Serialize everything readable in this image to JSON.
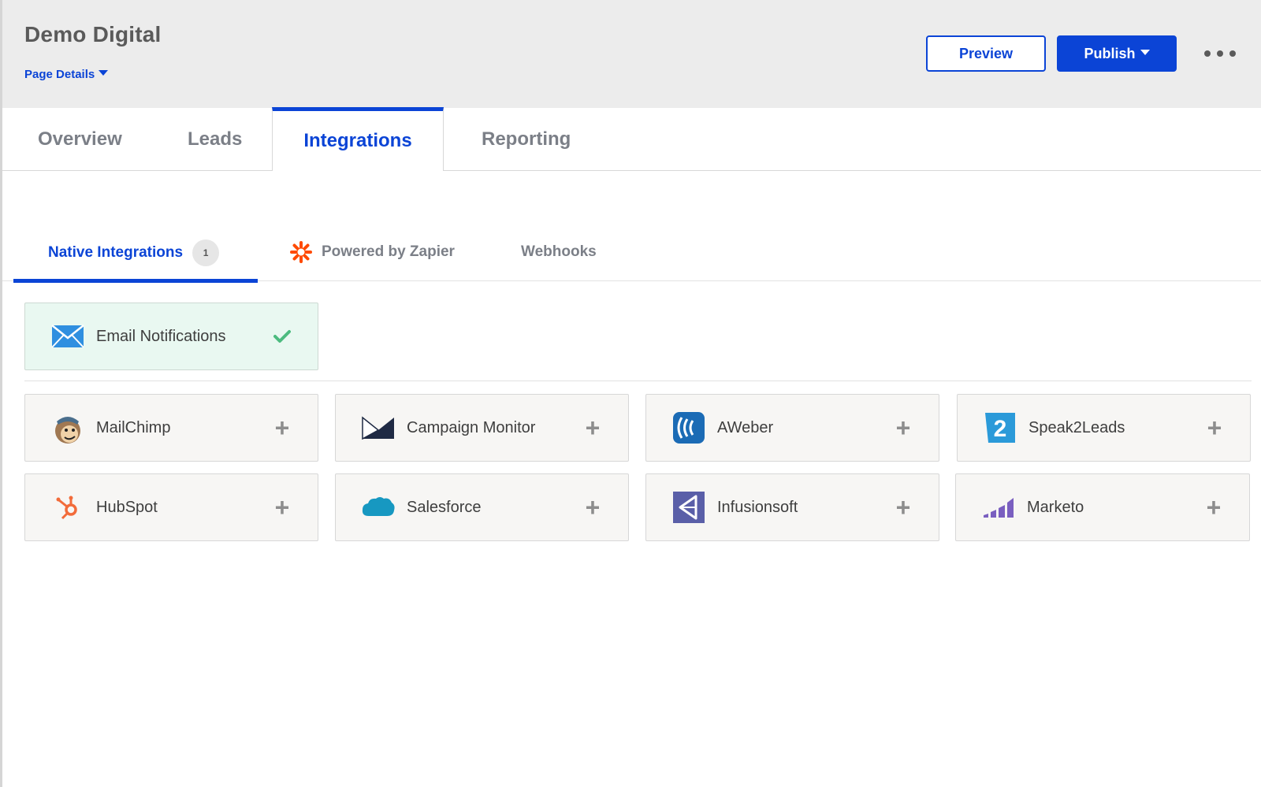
{
  "header": {
    "title": "Demo Digital",
    "page_details_label": "Page Details",
    "preview_label": "Preview",
    "publish_label": "Publish",
    "more_icon": "more-horizontal-icon"
  },
  "main_tabs": [
    {
      "label": "Overview",
      "active": false
    },
    {
      "label": "Leads",
      "active": false
    },
    {
      "label": "Integrations",
      "active": true
    },
    {
      "label": "Reporting",
      "active": false
    }
  ],
  "sub_tabs": [
    {
      "label": "Native Integrations",
      "badge": "1",
      "active": true
    },
    {
      "label": "Powered by Zapier",
      "icon": "zapier-icon",
      "active": false
    },
    {
      "label": "Webhooks",
      "active": false
    }
  ],
  "enabled_integrations": [
    {
      "name": "Email Notifications",
      "icon": "envelope-icon",
      "status": "enabled",
      "action_icon": "check-icon"
    }
  ],
  "available_integrations": [
    {
      "name": "MailChimp",
      "icon": "mailchimp-icon",
      "action_icon": "plus-icon"
    },
    {
      "name": "Campaign Monitor",
      "icon": "campaign-monitor-icon",
      "action_icon": "plus-icon"
    },
    {
      "name": "AWeber",
      "icon": "aweber-icon",
      "action_icon": "plus-icon"
    },
    {
      "name": "Speak2Leads",
      "icon": "speak2leads-icon",
      "action_icon": "plus-icon"
    },
    {
      "name": "HubSpot",
      "icon": "hubspot-icon",
      "action_icon": "plus-icon"
    },
    {
      "name": "Salesforce",
      "icon": "salesforce-icon",
      "action_icon": "plus-icon"
    },
    {
      "name": "Infusionsoft",
      "icon": "infusionsoft-icon",
      "action_icon": "plus-icon"
    },
    {
      "name": "Marketo",
      "icon": "marketo-icon",
      "action_icon": "plus-icon"
    }
  ],
  "colors": {
    "accent": "#0b44d6",
    "header_bg": "#ececec",
    "enabled_bg": "#e9f8f1",
    "check_green": "#4cbb7f",
    "zapier_orange": "#ff4a00"
  }
}
